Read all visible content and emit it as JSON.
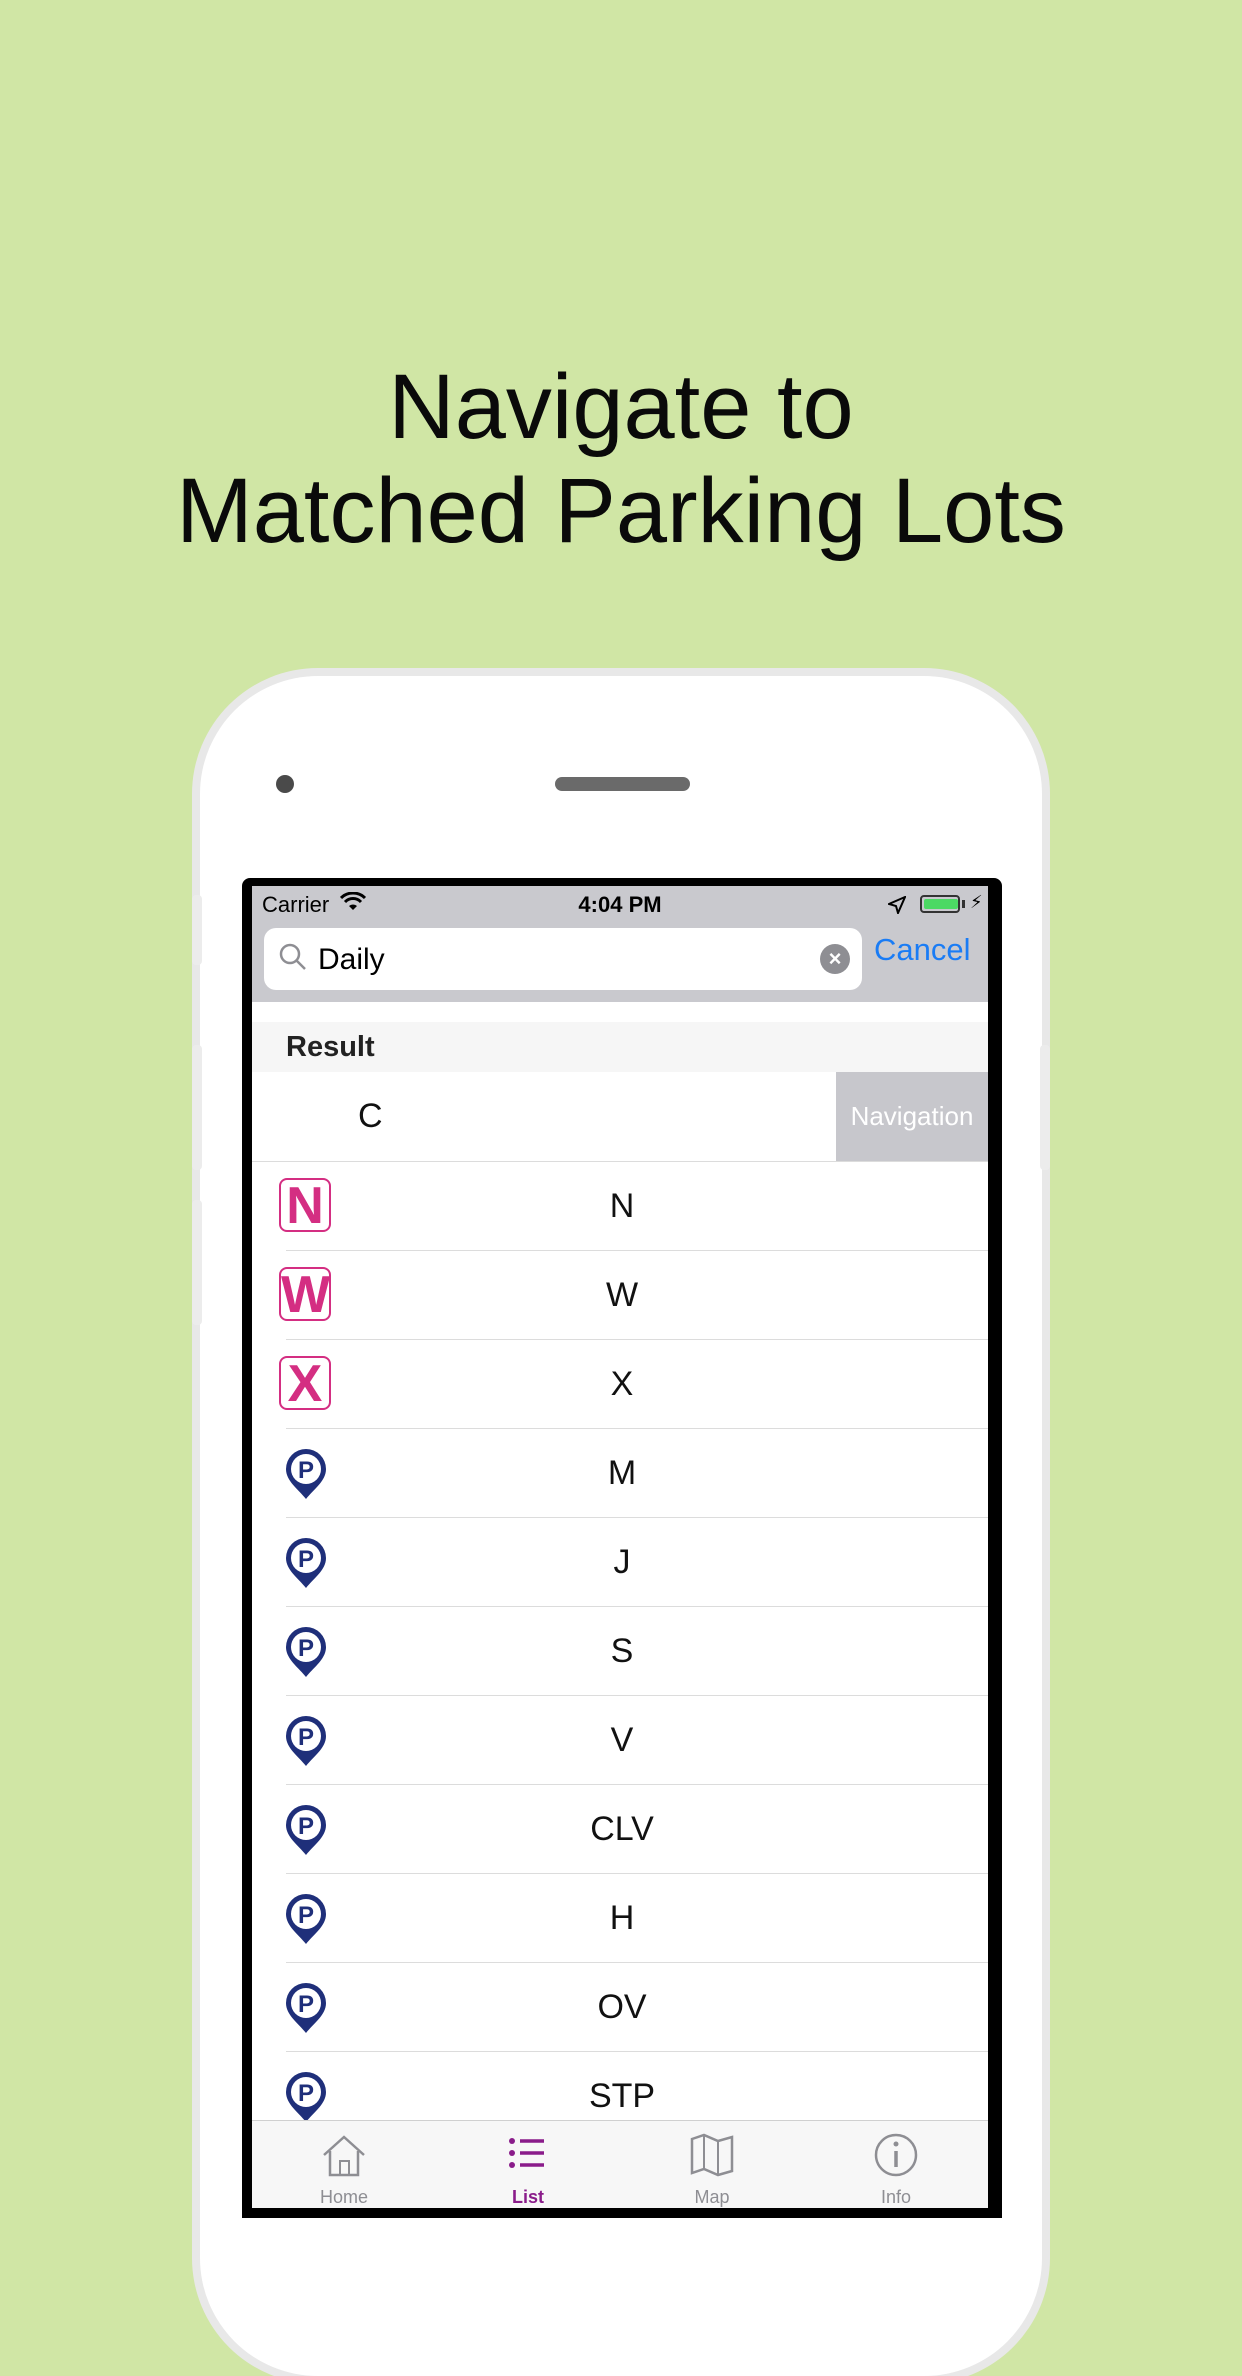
{
  "headline": {
    "line1": "Navigate to",
    "line2": "Matched Parking Lots"
  },
  "status_bar": {
    "carrier": "Carrier",
    "time": "4:04 PM"
  },
  "search": {
    "value": "Daily",
    "cancel_label": "Cancel"
  },
  "section": {
    "title": "Result"
  },
  "first_row": {
    "name": "C",
    "action_label": "Navigation"
  },
  "rows": [
    {
      "name": "N",
      "icon": "letter-n-icon",
      "badge": "N"
    },
    {
      "name": "W",
      "icon": "letter-w-icon",
      "badge": "W"
    },
    {
      "name": "X",
      "icon": "letter-x-icon",
      "badge": "X"
    },
    {
      "name": "M",
      "icon": "parking-pin-icon"
    },
    {
      "name": "J",
      "icon": "parking-pin-icon"
    },
    {
      "name": "S",
      "icon": "parking-pin-icon"
    },
    {
      "name": "V",
      "icon": "parking-pin-icon"
    },
    {
      "name": "CLV",
      "icon": "parking-pin-icon"
    },
    {
      "name": "H",
      "icon": "parking-pin-icon"
    },
    {
      "name": "OV",
      "icon": "parking-pin-icon"
    },
    {
      "name": "STP",
      "icon": "parking-pin-icon"
    }
  ],
  "tabs": [
    {
      "label": "Home",
      "icon": "home-icon"
    },
    {
      "label": "List",
      "icon": "list-icon",
      "active": true
    },
    {
      "label": "Map",
      "icon": "map-icon"
    },
    {
      "label": "Info",
      "icon": "info-icon"
    }
  ],
  "colors": {
    "background": "#d0e6a5",
    "accent": "#1a7cf5",
    "badge": "#d42e82",
    "parking_pin": "#1f2f7a",
    "active_tab": "#8a1c8a"
  }
}
